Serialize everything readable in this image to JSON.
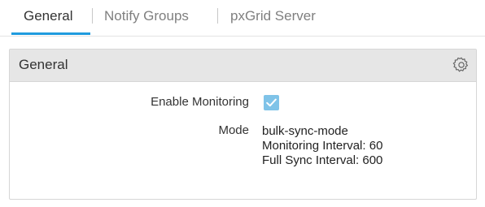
{
  "tabs": [
    {
      "label": "General",
      "active": true
    },
    {
      "label": "Notify Groups",
      "active": false
    },
    {
      "label": "pxGrid Server",
      "active": false
    }
  ],
  "panel": {
    "title": "General",
    "settings_icon": "gear-icon",
    "fields": {
      "enable_monitoring": {
        "label": "Enable Monitoring",
        "checked": true
      },
      "mode": {
        "label": "Mode",
        "lines": [
          "bulk-sync-mode",
          "Monitoring Interval: 60",
          "Full Sync Interval: 600"
        ]
      }
    }
  },
  "colors": {
    "accent": "#1f9bde",
    "checkbox": "#7fc3e8",
    "header_bg": "#e6e6e6"
  }
}
